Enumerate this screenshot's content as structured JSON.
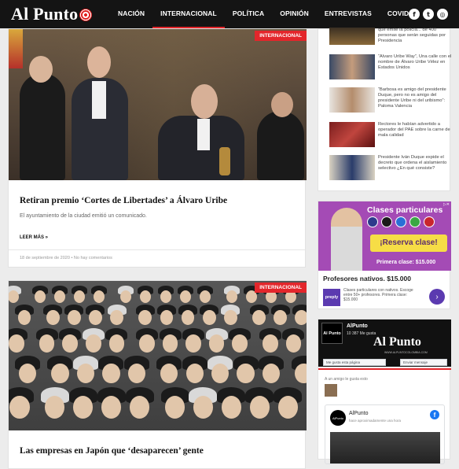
{
  "header": {
    "logo_text": "Al Punto",
    "nav": [
      {
        "label": "NACIÓN"
      },
      {
        "label": "INTERNACIONAL"
      },
      {
        "label": "POLÍTICA"
      },
      {
        "label": "OPINIÓN"
      },
      {
        "label": "ENTREVISTAS"
      },
      {
        "label": "COVID-19"
      }
    ],
    "active_nav": "INTERNACIONAL",
    "social_icons": [
      "facebook-icon",
      "twitter-icon",
      "instagram-icon"
    ],
    "social_glyphs": [
      "f",
      "t",
      "◎"
    ]
  },
  "articles": [
    {
      "badge": "INTERNACIONAL",
      "title": "Retiran premio ‘Cortes de Libertades’ a Álvaro Uribe",
      "excerpt": "El ayuntamiento de la ciudad emitió un comunicado.",
      "read_more": "LEER MÁS »",
      "date": "18 de septiembre de 2020",
      "comments": "No hay comentarios"
    },
    {
      "badge": "INTERNACIONAL",
      "title": "Las empresas en Japón que ‘desaparecen’ gente"
    }
  ],
  "sidebar": {
    "recent": [
      {
        "text": "que emite la policía... de 400 personas que serán seguidas por Presidencia"
      },
      {
        "text": "“Alvaro Uribe Way”, Una calle con el nombre de Álvaro Uribe Vélez en Estados Unidos"
      },
      {
        "text": "“Barbosa es amigo del presidente Duque, pero no es amigo del presidente Uribe ni del uribismo”: Paloma Valencia"
      },
      {
        "text": "Rectores le habían advertido a operador del PAE sobre la carne de mala calidad"
      },
      {
        "text": "Presidente Iván Duque expide el decreto que ordena el aislamiento selectivo ¿En qué consiste?"
      }
    ],
    "ad": {
      "banner_title": "Clases particulares",
      "cta": "¡Reserva clase!",
      "price_banner": "Primera clase: $15.000",
      "title": "Profesores nativos. $15.000",
      "brand": "preply",
      "description": "Clases particulares con nativos. Escoge entre 50+ profesores. Primera clase: $15.000",
      "arrow": "›",
      "flag_colors": [
        "#2d3a8c",
        "#1a1a1a",
        "#2a6fd6",
        "#3aa843",
        "#c9252d"
      ]
    },
    "facebook": {
      "cover_logo": "Al Punto",
      "cover_url": "WWW.ALPUNTOCOLOMBIA.COM",
      "avatar_text": "Al Punto",
      "page_name": "AlPunto",
      "likes": "10 387 Me gusta",
      "like_button": "Me gusta esta página",
      "message_button": "Enviar mensaje",
      "friend_line": "A un amigo le gusta esto",
      "post_name": "AlPunto",
      "post_time": "hace aproximadamente una hora",
      "post_avatar_text": "AlPunto"
    }
  }
}
